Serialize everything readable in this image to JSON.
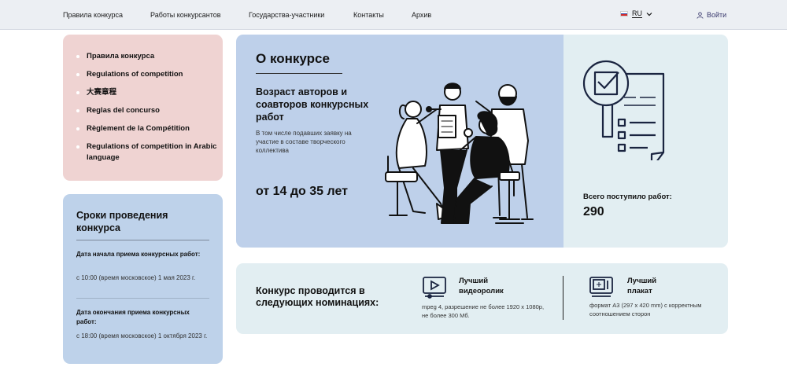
{
  "nav": {
    "items": [
      "Правила конкурса",
      "Работы конкурсантов",
      "Государства-участники",
      "Контакты",
      "Архив"
    ],
    "language": "RU",
    "login": "Войти"
  },
  "rules": {
    "items": [
      "Правила конкурса",
      "Regulations of competition",
      "大赛章程",
      "Reglas del concurso",
      "Règlement de la Compétition",
      "Regulations of competition in Arabic language"
    ]
  },
  "dates": {
    "title": "Сроки проведения конкурса",
    "start_label": "Дата начала приема конкурсных работ:",
    "start_value": "с 10:00 (время московское) 1 мая 2023 г.",
    "end_label": "Дата окончания приема конкурсных работ:",
    "end_value": "с 18:00 (время московское) 1 октября 2023 г."
  },
  "about": {
    "title": "О конкурсе",
    "subtitle": "Возраст авторов и соавторов конкурсных работ",
    "note": "В том числе подавших заявку на участие в составе творческого коллектива",
    "age": "от 14 до 35 лет"
  },
  "works": {
    "label": "Всего поступило работ:",
    "count": "290"
  },
  "nominations": {
    "title": "Конкурс проводится в следующих номинациях:",
    "video": {
      "name": "Лучший видеоролик",
      "desc": "mpeg 4, разрешение не более 1920 x 1080p, не более 300 Мб.",
      "icon": "video-player-icon"
    },
    "poster": {
      "name": "Лучший плакат",
      "desc": "формат А3 (297 x 420 mm) с корректным соотношением сторон",
      "icon": "poster-monitor-icon"
    }
  },
  "colors": {
    "pink_card": "#efd3d2",
    "blue_card": "#bed0ea",
    "light_card": "#e2eef2",
    "topbar": "#eceff3"
  }
}
